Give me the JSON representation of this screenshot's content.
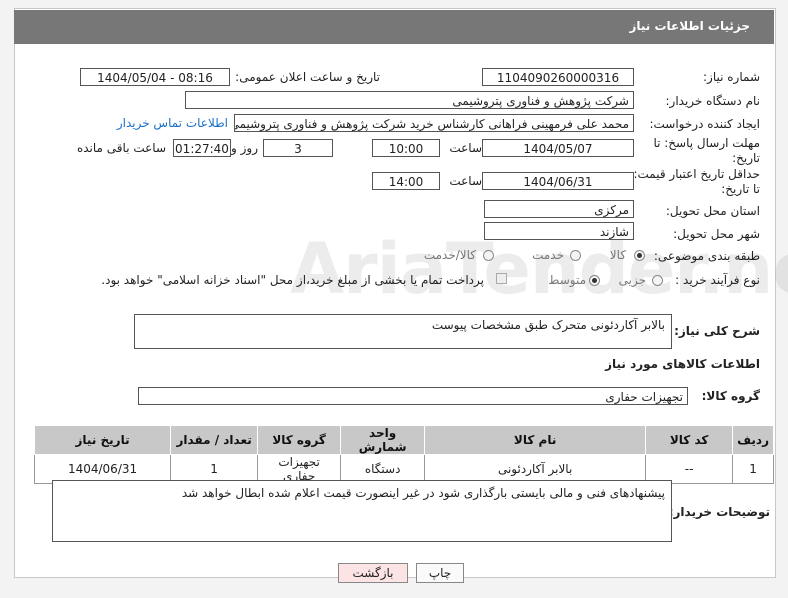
{
  "header": {
    "title": "جزئیات اطلاعات نیاز"
  },
  "form": {
    "need_number_label": "شماره نیاز:",
    "need_number": "1104090260000316",
    "announce_label": "تاریخ و ساعت اعلان عمومی:",
    "announce_value": "1404/05/04 - 08:16",
    "buyer_org_label": "نام دستگاه خریدار:",
    "buyer_org": "شرکت پژوهش و فناوری پتروشیمی",
    "requester_label": "ایجاد کننده درخواست:",
    "requester": "محمد علی فرمهینی فراهانی کارشناس خرید شرکت پژوهش و فناوری پتروشیمی",
    "contact_link": "اطلاعات تماس خریدار",
    "deadline_label_1": "مهلت ارسال پاسخ: تا",
    "deadline_label_2": "تاریخ:",
    "deadline_date": "1404/05/07",
    "time_label": "ساعت",
    "deadline_time": "10:00",
    "days_value": "3",
    "days_label": "روز و",
    "remaining_value": "01:27:40",
    "remaining_label": "ساعت باقی مانده",
    "validity_label_1": "حداقل تاریخ اعتبار قیمت:",
    "validity_label_2": "تا تاریخ:",
    "validity_date": "1404/06/31",
    "validity_time_label": "ساعت",
    "validity_time": "14:00",
    "province_label": "استان محل تحویل:",
    "province": "مرکزی",
    "city_label": "شهر محل تحویل:",
    "city": "شازند",
    "category_label": "طبقه بندی موضوعی:",
    "category_options": [
      "کالا",
      "خدمت",
      "کالا/خدمت"
    ],
    "purchase_type_label": "نوع فرآیند خرید :",
    "purchase_options": [
      "جزیی",
      "متوسط"
    ],
    "payment_note": "پرداخت تمام یا بخشی از مبلغ خرید،از محل \"اسناد خزانه اسلامی\" خواهد بود."
  },
  "description": {
    "label": "شرح کلی نیاز:",
    "text": "بالابر آکاردئونی متحرک طبق مشخصات پیوست"
  },
  "goods_info_title": "اطلاعات کالاهای مورد نیاز",
  "goods_group": {
    "label": "گروه کالا:",
    "value": "تجهیزات حفاری"
  },
  "table": {
    "headers": [
      "ردیف",
      "کد کالا",
      "نام کالا",
      "واحد شمارش",
      "گروه کالا",
      "تعداد / مقدار",
      "تاریخ نیاز"
    ],
    "rows": [
      [
        "1",
        "--",
        "بالابر آکاردئونی",
        "دستگاه",
        "تجهیزات حفاری",
        "1",
        "1404/06/31"
      ]
    ]
  },
  "buyer_notes": {
    "label": "توضیحات خریدار:",
    "text": "پیشنهادهای فنی و مالی بایستی بارگذاری شود در غیر اینصورت قیمت اعلام شده ابطال خواهد شد"
  },
  "buttons": {
    "print": "چاپ",
    "back": "بازگشت"
  },
  "watermark": "AriaTender.neT",
  "colors": {
    "header_bg": "#777777",
    "link": "#1a6fc4",
    "back_button_bg": "#fde4e4"
  }
}
